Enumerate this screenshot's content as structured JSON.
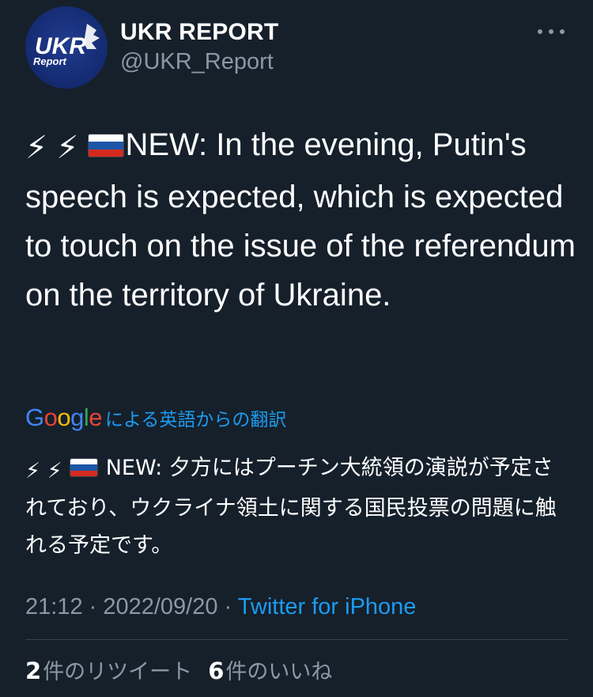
{
  "account": {
    "display_name": "UKR REPORT",
    "handle": "@UKR_Report",
    "avatar_text_top": "UKR",
    "avatar_text_bottom": "Report"
  },
  "tweet": {
    "emoji_1": "⚡",
    "emoji_2": "⚡",
    "flag": "russia-flag-icon",
    "text": "NEW: In the evening, Putin's speech is expected, which is expected to touch on the issue of the referendum on the territory of Ukraine."
  },
  "translation": {
    "provider": "Google",
    "label": "による英語からの翻訳",
    "emoji_1": "⚡",
    "emoji_2": "⚡",
    "text": "NEW: 夕方にはプーチン大統領の演説が予定されており、ウクライナ領土に関する国民投票の問題に触れる予定です。"
  },
  "meta": {
    "time": "21:12",
    "separator": " · ",
    "date": "2022/09/20",
    "source": "Twitter for iPhone"
  },
  "stats": {
    "retweets_count": "2",
    "retweets_label": "件のリツイート",
    "likes_count": "6",
    "likes_label": "件のいいね"
  },
  "colors": {
    "background": "#15202b",
    "text": "#ffffff",
    "secondary": "#8b98a5",
    "link": "#1d9bf0",
    "divider": "#38444d"
  }
}
